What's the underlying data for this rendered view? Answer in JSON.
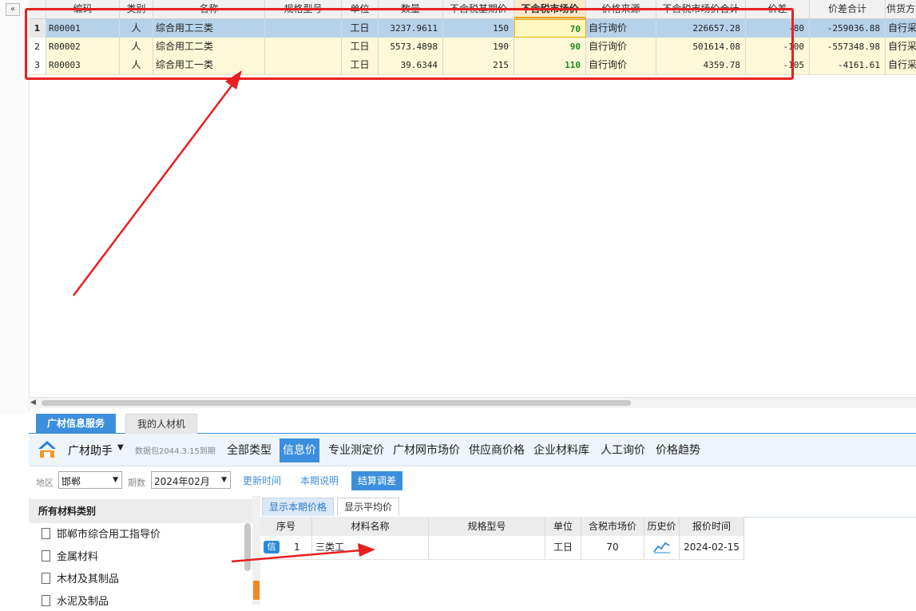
{
  "left_rail": {
    "collapse_icon": "«"
  },
  "grid": {
    "headers": [
      "",
      "编码",
      "类别",
      "名称",
      "规格型号",
      "单位",
      "数量",
      "不含税基期价",
      "不含税市场价",
      "价格来源",
      "不含税市场价合计",
      "价差",
      "价差合计",
      "供货方"
    ],
    "active_header": "不含税市场价",
    "rows": [
      {
        "no": "1",
        "code": "R00001",
        "type": "人",
        "name": "综合用工三类",
        "spec": "",
        "unit": "工日",
        "qty": "3237.9611",
        "base_price": "150",
        "market_price": "70",
        "source": "自行询价",
        "market_total": "226657.28",
        "diff": "-80",
        "diff_total": "-259036.88",
        "supply": "自行采"
      },
      {
        "no": "2",
        "code": "R00002",
        "type": "人",
        "name": "综合用工二类",
        "spec": "",
        "unit": "工日",
        "qty": "5573.4898",
        "base_price": "190",
        "market_price": "90",
        "source": "自行询价",
        "market_total": "501614.08",
        "diff": "-100",
        "diff_total": "-557348.98",
        "supply": "自行采"
      },
      {
        "no": "3",
        "code": "R00003",
        "type": "人",
        "name": "综合用工一类",
        "spec": "",
        "unit": "工日",
        "qty": "39.6344",
        "base_price": "215",
        "market_price": "110",
        "source": "自行询价",
        "market_total": "4359.78",
        "diff": "-105",
        "diff_total": "-4161.61",
        "supply": "自行采"
      }
    ]
  },
  "panel_tabs": {
    "active": "广材信息服务",
    "inactive": "我的人材机"
  },
  "toolbar": {
    "brand": "广材助手",
    "version": "数据包2044.3.15到期",
    "nav": [
      "全部类型",
      "信息价",
      "专业测定价",
      "广材网市场价",
      "供应商价格",
      "企业材料库",
      "人工询价",
      "价格趋势"
    ],
    "active_nav": "信息价"
  },
  "filters": {
    "region_label": "地区",
    "region_value": "邯郸",
    "period_label": "期数",
    "period_value": "2024年02月",
    "update_time": "更新时间",
    "period_note": "本期说明",
    "settle_diff": "结算调差"
  },
  "categories": {
    "header": "所有材料类别",
    "items": [
      "邯郸市综合用工指导价",
      "金属材料",
      "木材及其制品",
      "水泥及制品"
    ]
  },
  "price_panel": {
    "tab_current": "显示本期价格",
    "tab_avg": "显示平均价",
    "headers": [
      "序号",
      "材料名称",
      "规格型号",
      "单位",
      "含税市场价",
      "历史价",
      "报价时间"
    ],
    "row": {
      "badge": "信",
      "no": "1",
      "name": "三类工",
      "spec": "",
      "unit": "工日",
      "price": "70",
      "date": "2024-02-15"
    }
  },
  "colors": {
    "accent": "#3c8fdc",
    "highlight_red": "#e82020",
    "row_yellow": "#fdf8d7",
    "row_selected": "#b6d2ea"
  }
}
